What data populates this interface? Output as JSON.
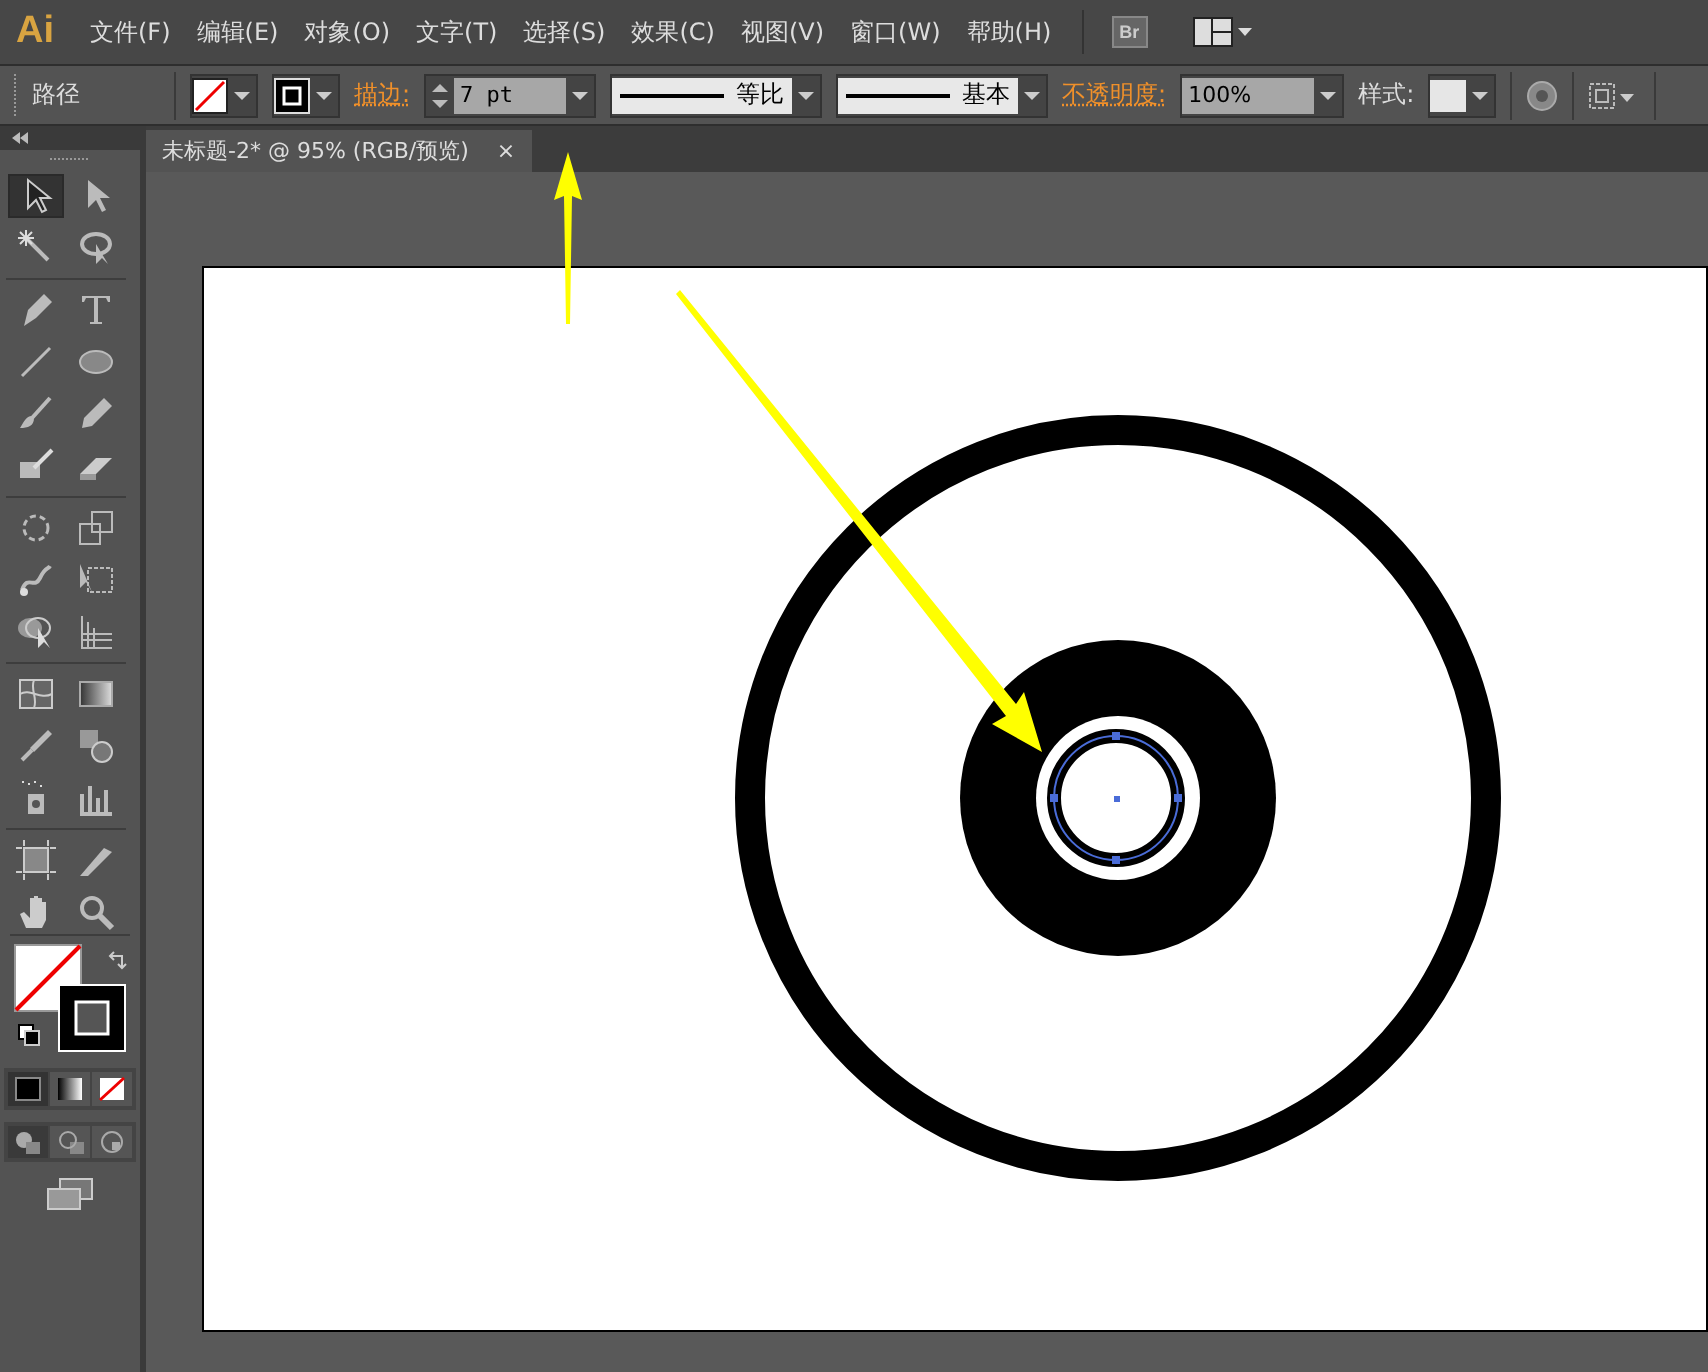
{
  "app_logo": "Ai",
  "menu": [
    "文件(F)",
    "编辑(E)",
    "对象(O)",
    "文字(T)",
    "选择(S)",
    "效果(C)",
    "视图(V)",
    "窗口(W)",
    "帮助(H)"
  ],
  "bridge_button": "Br",
  "control_bar": {
    "selection_type": "路径",
    "stroke_label": "描边:",
    "stroke_weight": "7 pt",
    "profile": "等比",
    "brush": "基本",
    "opacity_label": "不透明度:",
    "opacity": "100%",
    "style_label": "样式:"
  },
  "document_tab": {
    "title": "未标题-2* @ 95% (RGB/预览)",
    "close": "×"
  },
  "tools": [
    {
      "kind": "selection",
      "selected": true
    },
    {
      "kind": "direct",
      "selected": false
    },
    {
      "kind": "wand",
      "selected": false
    },
    {
      "kind": "lasso",
      "selected": false
    },
    {
      "kind": "pen",
      "selected": false
    },
    {
      "kind": "type",
      "selected": false
    },
    {
      "kind": "line",
      "selected": false
    },
    {
      "kind": "ellipse",
      "selected": false
    },
    {
      "kind": "brush",
      "selected": false
    },
    {
      "kind": "pencil",
      "selected": false
    },
    {
      "kind": "blob",
      "selected": false
    },
    {
      "kind": "eraser",
      "selected": false
    },
    {
      "kind": "rotate",
      "selected": false
    },
    {
      "kind": "scale",
      "selected": false
    },
    {
      "kind": "warp",
      "selected": false
    },
    {
      "kind": "freetransform",
      "selected": false
    },
    {
      "kind": "shapebuilder",
      "selected": false
    },
    {
      "kind": "perspective",
      "selected": false
    },
    {
      "kind": "mesh",
      "selected": false
    },
    {
      "kind": "gradient",
      "selected": false
    },
    {
      "kind": "eyedropper",
      "selected": false
    },
    {
      "kind": "blend",
      "selected": false
    },
    {
      "kind": "spray",
      "selected": false
    },
    {
      "kind": "graph",
      "selected": false
    },
    {
      "kind": "artboard",
      "selected": false
    },
    {
      "kind": "slice",
      "selected": false
    },
    {
      "kind": "hand",
      "selected": false
    },
    {
      "kind": "zoom",
      "selected": false
    }
  ],
  "draw_modes": [
    {
      "kind": "normal",
      "selected": true
    },
    {
      "kind": "behind",
      "selected": false
    },
    {
      "kind": "inside",
      "selected": false
    }
  ]
}
